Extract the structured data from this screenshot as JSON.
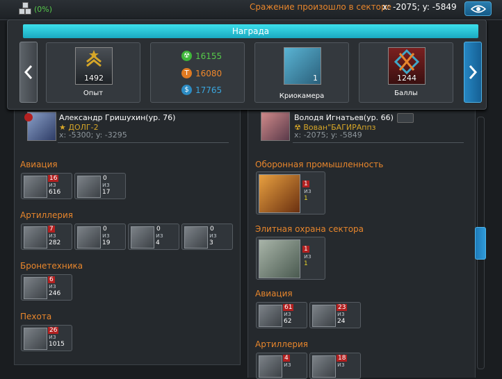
{
  "topbar": {
    "percent": "(0%)",
    "battle_message": "Сражение произошло в секторе",
    "battle_coords": "x: -2075; y: -5849"
  },
  "reward": {
    "title": "Награда",
    "experience": {
      "value": "1492",
      "label": "Опыт"
    },
    "resources": [
      {
        "icon": "radiation-icon",
        "value": "16155",
        "color": "#56c94a"
      },
      {
        "icon": "titanium-icon",
        "value": "16080",
        "color": "#f0882c"
      },
      {
        "icon": "credits-icon",
        "value": "17765",
        "color": "#3aa6de"
      }
    ],
    "cryo": {
      "badge": "1",
      "label": "Криокамера"
    },
    "points": {
      "value": "1244",
      "label": "Баллы"
    }
  },
  "left_player": {
    "name": "Александр Гришухин(ур. 76)",
    "alliance": "ДОЛГ-2",
    "coords": "x: -5300; y: -3295",
    "categories": [
      {
        "title": "Авиация",
        "units": [
          {
            "lost": "16",
            "iz": "из",
            "total": "616"
          },
          {
            "lost": "0",
            "iz": "из",
            "total": "17"
          }
        ]
      },
      {
        "title": "Артиллерия",
        "units": [
          {
            "lost": "7",
            "iz": "из",
            "total": "282"
          },
          {
            "lost": "0",
            "iz": "из",
            "total": "19"
          },
          {
            "lost": "0",
            "iz": "из",
            "total": "4"
          },
          {
            "lost": "0",
            "iz": "из",
            "total": "3"
          }
        ]
      },
      {
        "title": "Бронетехника",
        "units": [
          {
            "lost": "6",
            "iz": "из",
            "total": "246"
          }
        ]
      },
      {
        "title": "Пехота",
        "units": [
          {
            "lost": "26",
            "iz": "из",
            "total": "1015"
          }
        ]
      }
    ]
  },
  "right_player": {
    "name": "Володя Игнатьев(ур. 66)",
    "alliance": "Вован\"БАГИРАппз",
    "coords": "x: -2075; y: -5849",
    "categories": [
      {
        "title": "Оборонная промышленность",
        "units": [
          {
            "lost": "1",
            "iz": "из",
            "total": "1"
          }
        ]
      },
      {
        "title": "Элитная охрана сектора",
        "units": [
          {
            "lost": "1",
            "iz": "из",
            "total": "1"
          }
        ]
      },
      {
        "title": "Авиация",
        "units": [
          {
            "lost": "61",
            "iz": "из",
            "total": "62"
          },
          {
            "lost": "23",
            "iz": "из",
            "total": "24"
          }
        ]
      },
      {
        "title": "Артиллерия",
        "units": [
          {
            "lost": "4",
            "iz": "из",
            "total": ""
          },
          {
            "lost": "18",
            "iz": "из",
            "total": ""
          }
        ]
      }
    ]
  }
}
